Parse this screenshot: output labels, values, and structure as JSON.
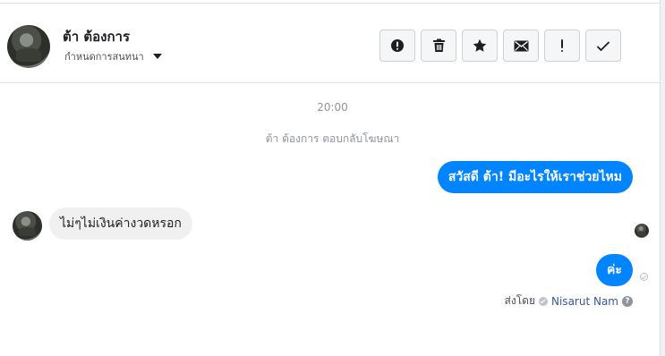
{
  "header": {
    "name": "ต้า ต้องการ",
    "subtitle": "กำหนดการสนทนา",
    "actions": [
      {
        "icon": "alert-circle-icon",
        "glyph": "!"
      },
      {
        "icon": "trash-icon"
      },
      {
        "icon": "star-icon"
      },
      {
        "icon": "envelope-icon"
      },
      {
        "icon": "exclamation-icon",
        "glyph": "!"
      },
      {
        "icon": "checkmark-icon"
      }
    ]
  },
  "conversation": {
    "timestamp": "20:00",
    "system_message": "ต้า ต้องการ ตอบกลับโฆษณา",
    "messages": [
      {
        "direction": "outgoing",
        "text": "สวัสดี ต้า! มีอะไรให้เราช่วยไหม"
      },
      {
        "direction": "incoming",
        "text": "ไม่ๆไม่เงินค่างวดหรอก"
      },
      {
        "direction": "outgoing",
        "text": "ค่ะ"
      }
    ],
    "sent_by": {
      "label": "ส่งโดย",
      "sender": "Nisarut Nam",
      "help": "?"
    }
  },
  "colors": {
    "accent": "#0084ff",
    "incoming_bubble": "#f1f0f0",
    "link": "#365899"
  }
}
